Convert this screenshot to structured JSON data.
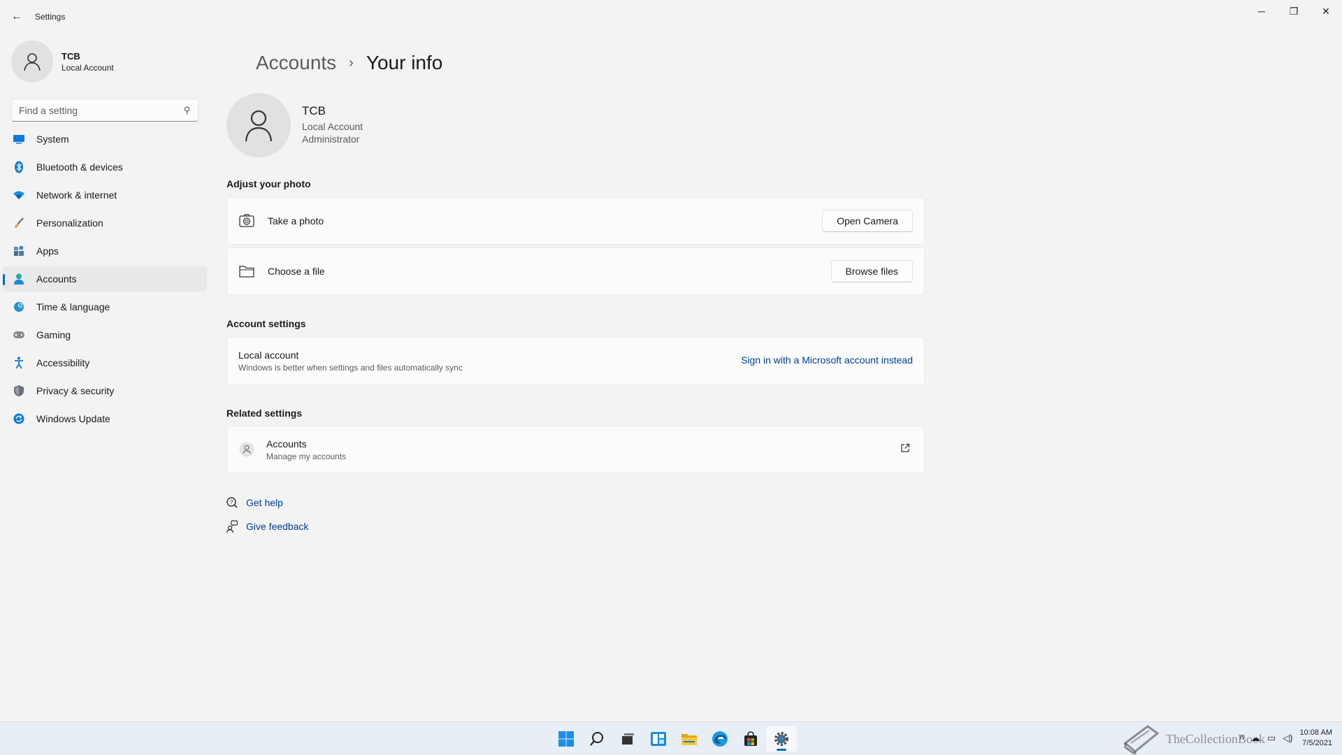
{
  "window": {
    "title": "Settings",
    "controls": {
      "minimize": "─",
      "restore": "❐",
      "close": "✕"
    },
    "back_glyph": "←"
  },
  "sidebar": {
    "profile": {
      "name": "TCB",
      "type": "Local Account"
    },
    "search": {
      "placeholder": "Find a setting",
      "value": ""
    },
    "items": [
      {
        "label": "System",
        "icon": "monitor-icon",
        "active": false
      },
      {
        "label": "Bluetooth & devices",
        "icon": "bluetooth-icon",
        "active": false
      },
      {
        "label": "Network & internet",
        "icon": "wifi-icon",
        "active": false
      },
      {
        "label": "Personalization",
        "icon": "brush-icon",
        "active": false
      },
      {
        "label": "Apps",
        "icon": "apps-icon",
        "active": false
      },
      {
        "label": "Accounts",
        "icon": "person-icon",
        "active": true
      },
      {
        "label": "Time & language",
        "icon": "globe-clock-icon",
        "active": false
      },
      {
        "label": "Gaming",
        "icon": "gamepad-icon",
        "active": false
      },
      {
        "label": "Accessibility",
        "icon": "accessibility-icon",
        "active": false
      },
      {
        "label": "Privacy & security",
        "icon": "shield-icon",
        "active": false
      },
      {
        "label": "Windows Update",
        "icon": "update-icon",
        "active": false
      }
    ]
  },
  "breadcrumb": {
    "parent": "Accounts",
    "separator": "›",
    "current": "Your info"
  },
  "user": {
    "name": "TCB",
    "account_type": "Local Account",
    "role": "Administrator"
  },
  "adjust_photo": {
    "title": "Adjust your photo",
    "take_photo": {
      "label": "Take a photo",
      "button": "Open Camera"
    },
    "choose_file": {
      "label": "Choose a file",
      "button": "Browse files"
    }
  },
  "account_settings": {
    "title": "Account settings",
    "local_account": {
      "title": "Local account",
      "description": "Windows is better when settings and files automatically sync",
      "link": "Sign in with a Microsoft account instead"
    }
  },
  "related_settings": {
    "title": "Related settings",
    "accounts": {
      "title": "Accounts",
      "description": "Manage my accounts"
    }
  },
  "help": {
    "get_help": "Get help",
    "give_feedback": "Give feedback"
  },
  "taskbar": {
    "icons": [
      "start-icon",
      "search-icon",
      "task-view-icon",
      "widgets-icon",
      "file-explorer-icon",
      "edge-icon",
      "store-icon",
      "settings-icon"
    ],
    "active_icon": "settings-icon",
    "time": "10:08 AM",
    "date": "7/5/2021",
    "watermark": "TheCollectionBook"
  },
  "colors": {
    "accent": "#0067c0",
    "link": "#003e92",
    "background": "#f3f3f3",
    "card": "#fbfbfb"
  }
}
